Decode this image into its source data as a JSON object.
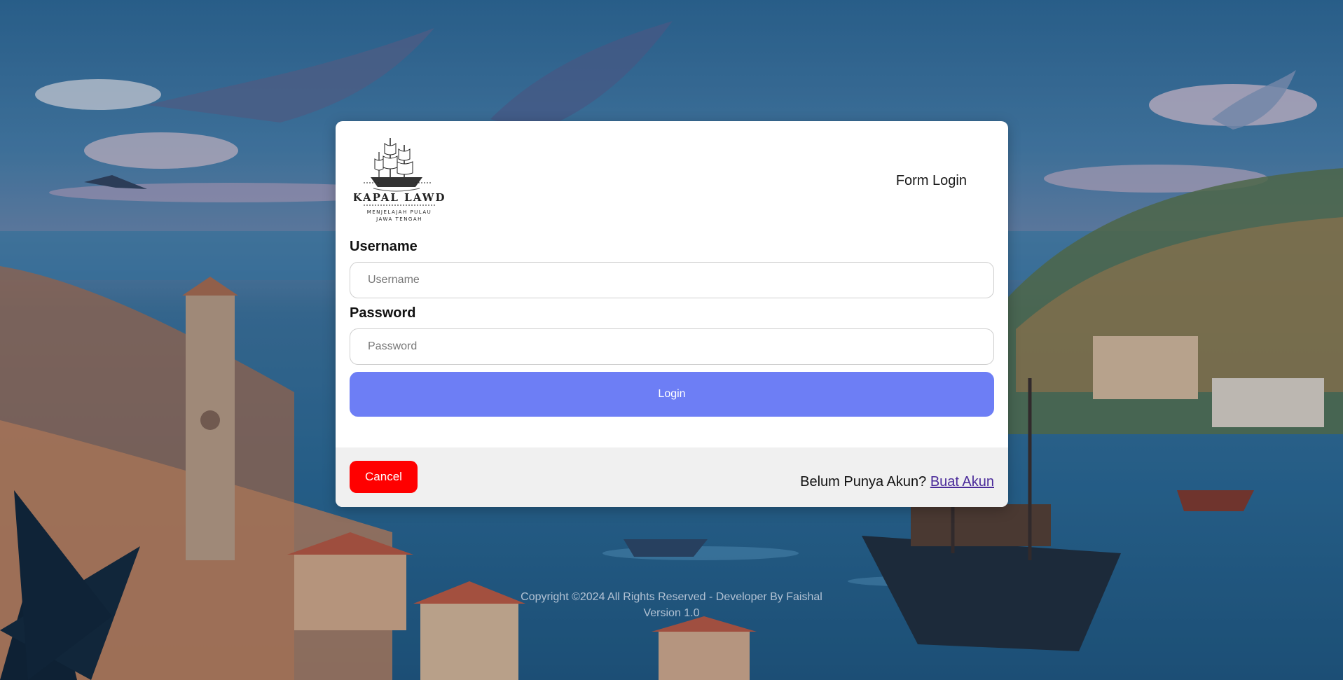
{
  "logo": {
    "name": "KAPAL LAWD",
    "tagline_line1": "MENJELAJAH PULAU",
    "tagline_line2": "JAWA TENGAH"
  },
  "header": {
    "title": "Form Login"
  },
  "form": {
    "username": {
      "label": "Username",
      "placeholder": "Username",
      "value": ""
    },
    "password": {
      "label": "Password",
      "placeholder": "Password",
      "value": ""
    },
    "login_label": "Login"
  },
  "footer_bar": {
    "cancel_label": "Cancel",
    "signup_prompt": "Belum Punya Akun?",
    "signup_link": "Buat Akun"
  },
  "page_footer": {
    "copyright": "Copyright ©2024 All Rights Reserved - Developer By Faishal",
    "version": "Version 1.0"
  },
  "colors": {
    "primary_button": "#6d7ef5",
    "cancel_button": "#ff0000",
    "link": "#4a2a9a",
    "card": "#ffffff",
    "footer_bar": "#f0f0f0"
  },
  "icons": {
    "logo_emblem": "sailing-ship-icon"
  }
}
